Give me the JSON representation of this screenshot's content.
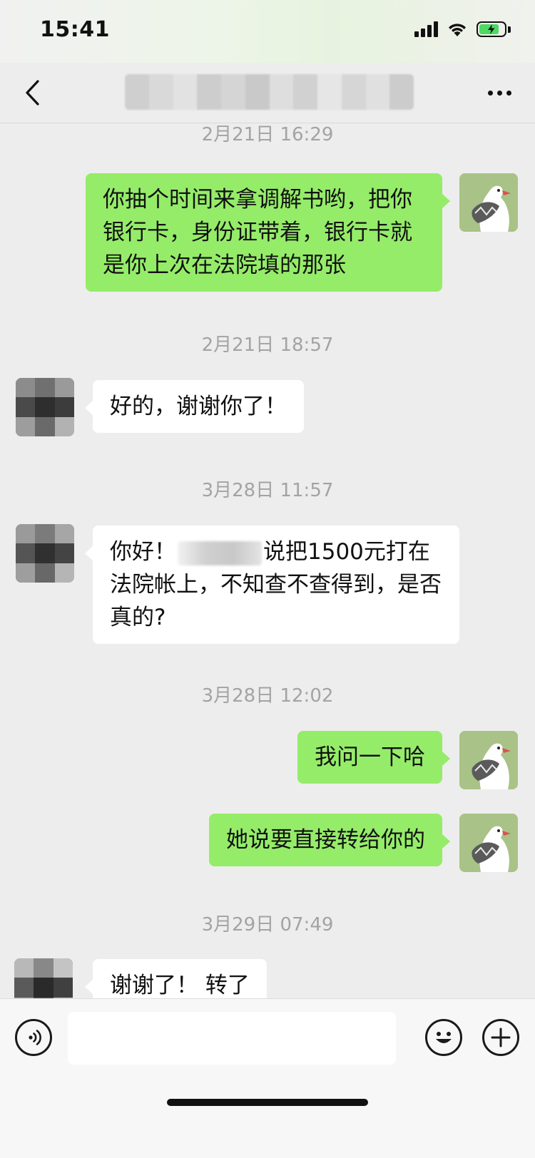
{
  "status_bar": {
    "time": "15:41"
  },
  "nav": {
    "title": "",
    "back_icon": "chevron-left-icon",
    "more_icon": "more-dots-icon"
  },
  "messages": [
    {
      "type": "timestamp",
      "text": "2月21日 16:29"
    },
    {
      "type": "message",
      "from": "me",
      "text": "你抽个时间来拿调解书哟，把你银行卡，身份证带着，银行卡就是你上次在法院填的那张"
    },
    {
      "type": "timestamp",
      "text": "2月21日 18:57"
    },
    {
      "type": "message",
      "from": "other",
      "text": "好的，谢谢你了！"
    },
    {
      "type": "timestamp",
      "text": "3月28日 11:57"
    },
    {
      "type": "message",
      "from": "other",
      "text_before": "你好！",
      "text_after": "说把1500元打在法院帐上，不知查不查得到，是否真的?"
    },
    {
      "type": "timestamp",
      "text": "3月28日 12:02"
    },
    {
      "type": "message",
      "from": "me",
      "text": "我问一下哈"
    },
    {
      "type": "message",
      "from": "me",
      "text": "她说要直接转给你的"
    },
    {
      "type": "timestamp",
      "text": "3月29日 07:49"
    },
    {
      "type": "message",
      "from": "other",
      "text": "谢谢了！ 转了"
    }
  ],
  "input_bar": {
    "voice_icon": "voice-icon",
    "emoji_icon": "emoji-icon",
    "plus_icon": "plus-icon",
    "text_value": ""
  },
  "colors": {
    "outgoing_bubble": "#95ec69",
    "incoming_bubble": "#ffffff",
    "background": "#ededed",
    "timestamp_text": "#a3a3a3"
  }
}
